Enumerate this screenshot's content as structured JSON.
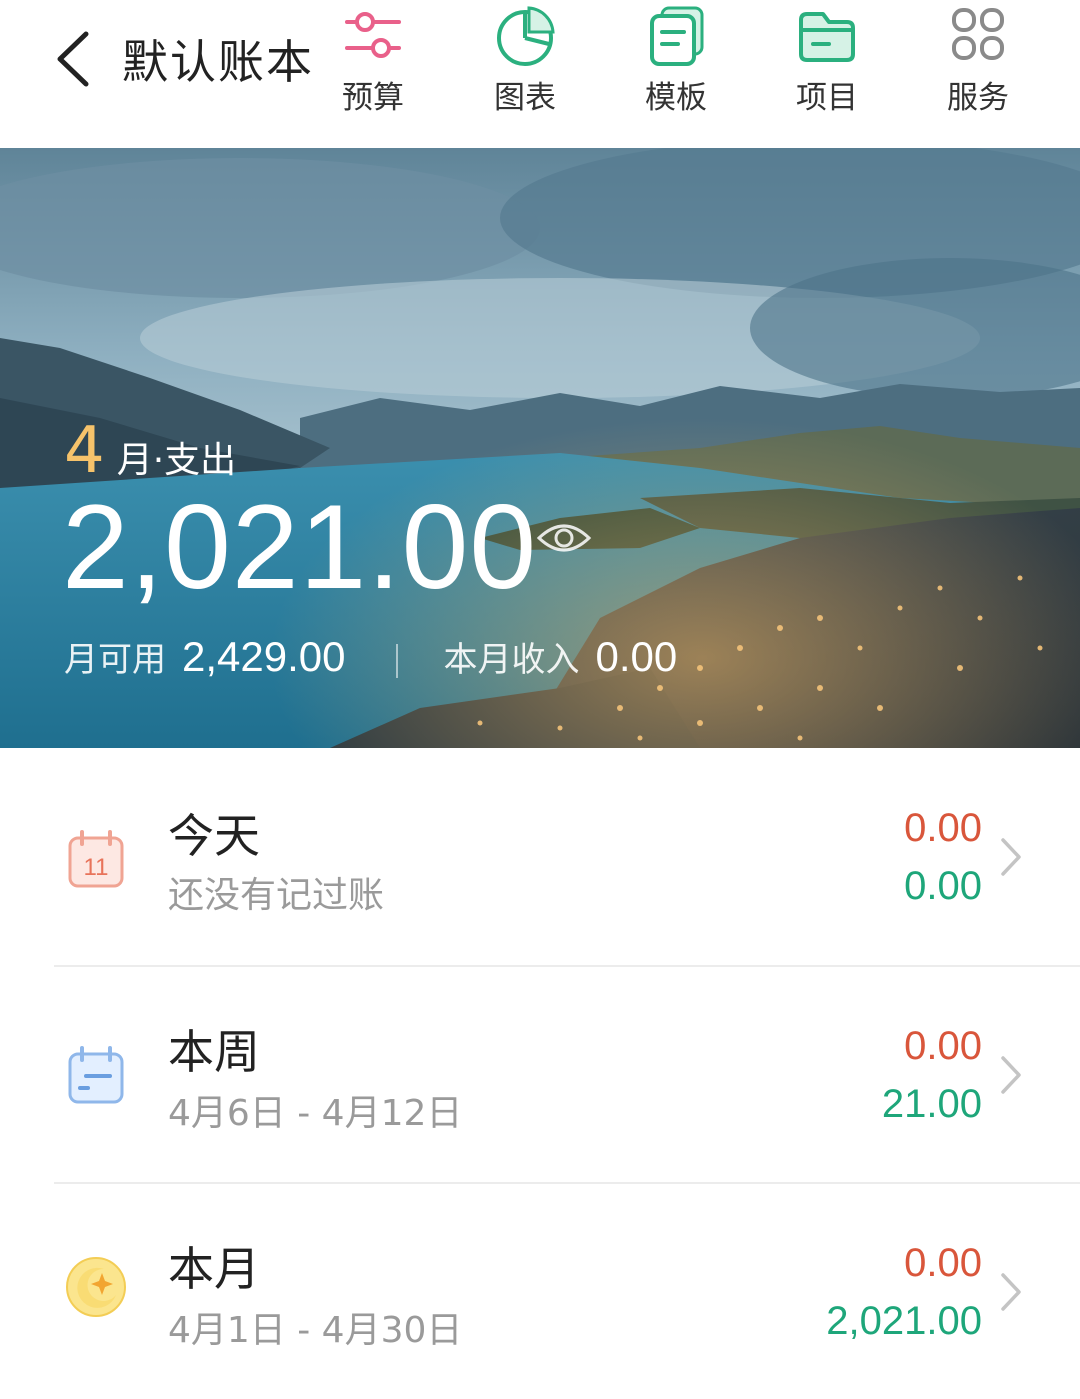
{
  "header": {
    "title": "默认账本",
    "tools": [
      {
        "label": "预算",
        "icon": "budget-sliders-icon",
        "color": "#e9608a"
      },
      {
        "label": "图表",
        "icon": "pie-chart-icon",
        "color": "#2bb07f"
      },
      {
        "label": "模板",
        "icon": "template-icon",
        "color": "#2bb07f"
      },
      {
        "label": "项目",
        "icon": "project-folder-icon",
        "color": "#2bb07f"
      },
      {
        "label": "服务",
        "icon": "services-grid-icon",
        "color": "#8a8a8a"
      }
    ]
  },
  "banner": {
    "month": "4",
    "month_suffix": "月·支出",
    "spend": "2,021.00",
    "available_label": "月可用",
    "available_value": "2,429.00",
    "income_label": "本月收入",
    "income_value": "0.00"
  },
  "rows": [
    {
      "title": "今天",
      "desc": "还没有记过账",
      "out": "0.00",
      "inc": "0.00",
      "icon": "calendar-day-icon",
      "day": "11"
    },
    {
      "title": "本周",
      "desc": "4月6日 - 4月12日",
      "out": "0.00",
      "inc": "21.00",
      "icon": "calendar-week-icon"
    },
    {
      "title": "本月",
      "desc": "4月1日 - 4月30日",
      "out": "0.00",
      "inc": "2,021.00",
      "icon": "moon-icon"
    }
  ],
  "colors": {
    "expense": "#d9563b",
    "income": "#1ea67a",
    "accent_month": "#f6c36b"
  }
}
